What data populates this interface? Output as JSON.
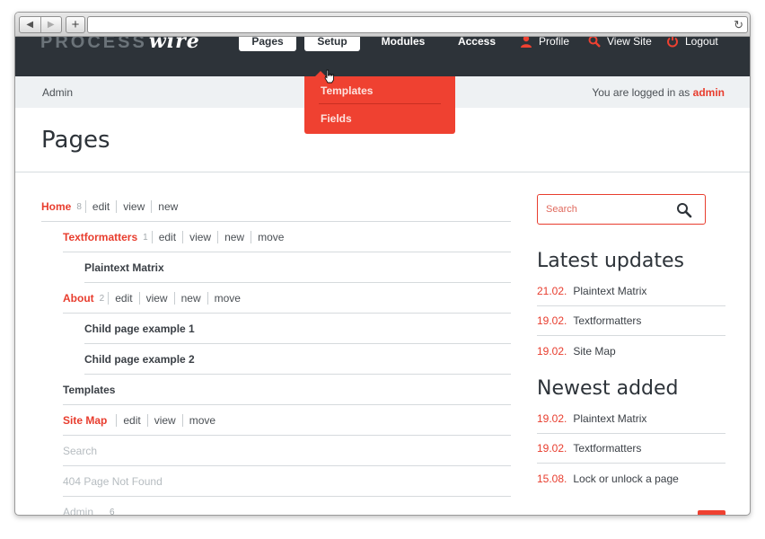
{
  "browser": {
    "back_glyph": "◀",
    "forward_glyph": "▶",
    "new_tab_glyph": "+",
    "reload_glyph": "↻"
  },
  "site": {
    "logo_text": "PROCESS",
    "logo_script": "wire",
    "nav": {
      "pages": "Pages",
      "setup": "Setup",
      "modules": "Modules",
      "access": "Access",
      "profile": "Profile",
      "view_site": "View Site",
      "logout": "Logout"
    },
    "breadcrumb": "Admin",
    "logged_in_prefix": "You are logged in as",
    "logged_in_user": "admin",
    "dropdown": {
      "templates": "Templates",
      "fields": "Fields"
    },
    "page_title": "Pages"
  },
  "tree": {
    "actions": {
      "edit": "edit",
      "view": "view",
      "new": "new",
      "move": "move"
    },
    "rows": [
      {
        "name": "Home",
        "count": "8"
      },
      {
        "name": "Textformatters",
        "count": "1"
      },
      {
        "name": "Plaintext Matrix"
      },
      {
        "name": "About",
        "count": "2"
      },
      {
        "name": "Child page example 1"
      },
      {
        "name": "Child page example 2"
      },
      {
        "name": "Templates"
      },
      {
        "name": "Site Map"
      },
      {
        "name": "Search"
      },
      {
        "name": "404 Page Not Found"
      },
      {
        "name": "Admin",
        "count": "6"
      }
    ]
  },
  "sidebar": {
    "search_placeholder": "Search",
    "latest_title": "Latest updates",
    "latest": [
      {
        "date": "21.02.",
        "name": "Plaintext Matrix"
      },
      {
        "date": "19.02.",
        "name": "Textformatters"
      },
      {
        "date": "19.02.",
        "name": "Site Map"
      }
    ],
    "newest_title": "Newest added",
    "newest": [
      {
        "date": "19.02.",
        "name": "Plaintext Matrix"
      },
      {
        "date": "19.02.",
        "name": "Textformatters"
      },
      {
        "date": "15.08.",
        "name": "Lock or unlock a page"
      }
    ]
  },
  "colors": {
    "accent": "#e83d2e",
    "masthead": "#2d3339",
    "dropdown": "#ef4131"
  },
  "icons": {
    "profile": "user-icon",
    "view_site": "search-icon",
    "logout": "power-icon",
    "back_to_top": "chevron-up-icon"
  }
}
